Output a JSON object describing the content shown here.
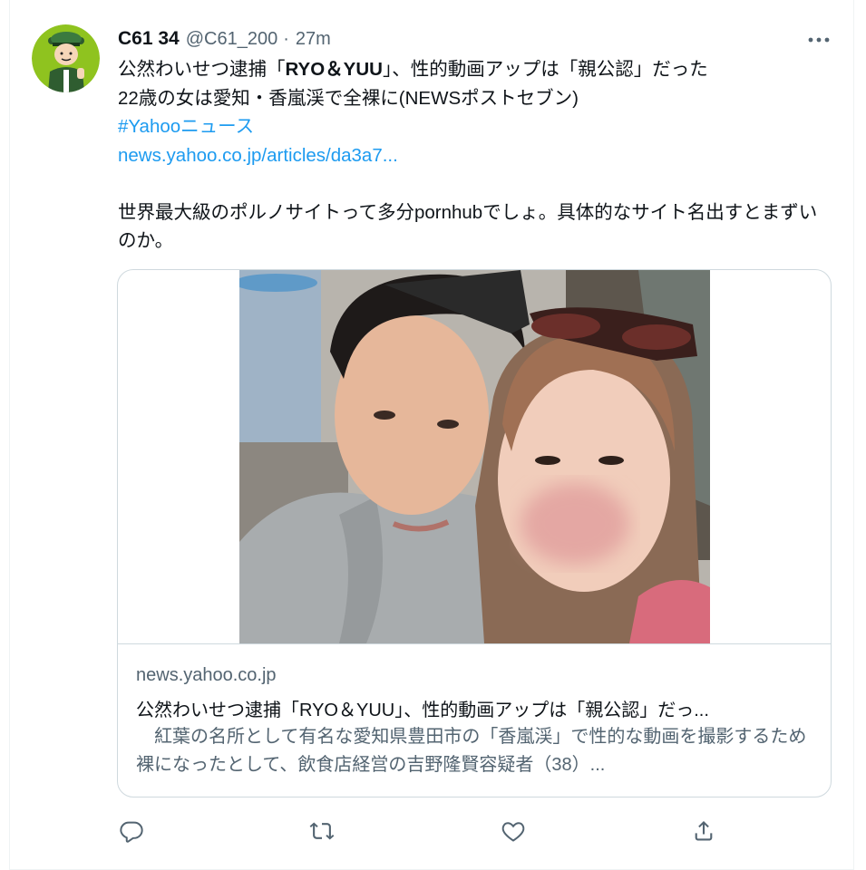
{
  "tweet": {
    "author_name": "C61 34",
    "author_handle": "@C61_200",
    "separator": "·",
    "time": "27m",
    "line1_pre": "公然わいせつ逮捕「",
    "line1_bold": "RYO＆YUU",
    "line1_post": "」、性的動画アップは「親公認」だった",
    "line2": "22歳の女は愛知・香嵐渓で全裸に(NEWSポストセブン)",
    "hashtag": "#Yahooニュース",
    "link": "news.yahoo.co.jp/articles/da3a7...",
    "comment": "世界最大級のポルノサイトって多分pornhubでしょ。具体的なサイト名出すとまずいのか。"
  },
  "card": {
    "domain": "news.yahoo.co.jp",
    "title": "公然わいせつ逮捕「RYO＆YUU」、性的動画アップは「親公認」だっ...",
    "description": "　紅葉の名所として有名な愛知県豊田市の「香嵐渓」で性的な動画を撮影するため裸になったとして、飲食店経営の吉野隆賢容疑者（38）..."
  },
  "icons": {
    "avatar": "police-officer-avatar",
    "more": "more-icon",
    "reply": "reply-icon",
    "retweet": "retweet-icon",
    "like": "like-icon",
    "share": "share-icon"
  },
  "colors": {
    "link": "#1d9bf0",
    "secondary_text": "#536471",
    "border": "#cfd9de"
  }
}
